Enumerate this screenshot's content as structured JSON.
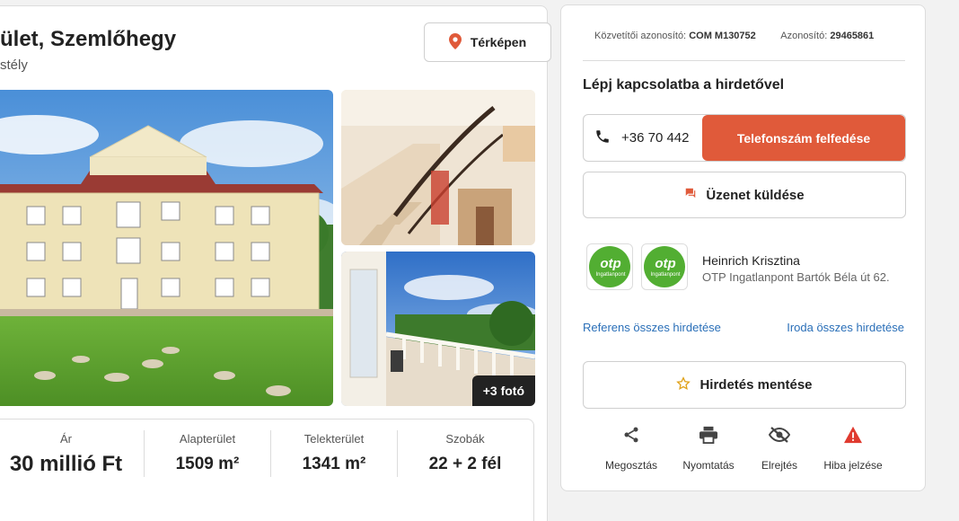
{
  "listing": {
    "title": "ület, Szemlőhegy",
    "subtitle": "stély",
    "map_button": "Térképen",
    "more_photos": "+3 fotó",
    "stats": [
      {
        "label": "Ár",
        "value": "30 millió Ft"
      },
      {
        "label": "Alapterület",
        "value": "1509 m²"
      },
      {
        "label": "Telekterület",
        "value": "1341 m²"
      },
      {
        "label": "Szobák",
        "value": "22 + 2 fél"
      }
    ]
  },
  "sidebar": {
    "broker_id_label": "Közvetítői azonosító:",
    "broker_id_value": "COM M130752",
    "id_label": "Azonosító:",
    "id_value": "29465861",
    "contact_title": "Lépj kapcsolatba a hirdetővel",
    "phone_partial": "+36 70 442",
    "reveal_button": "Telefonszám felfedése",
    "message_button": "Üzenet küldése",
    "logo_text": "otp",
    "logo_subtext": "Ingatlanpont",
    "agent_name": "Heinrich Krisztina",
    "agent_office": "OTP Ingatlanpont Bartók Béla út 62.",
    "link_agent": "Referens összes hirdetése",
    "link_office": "Iroda összes hirdetése",
    "save_button": "Hirdetés mentése",
    "actions": [
      {
        "label": "Megosztás",
        "icon": "share-icon"
      },
      {
        "label": "Nyomtatás",
        "icon": "print-icon"
      },
      {
        "label": "Elrejtés",
        "icon": "hide-icon"
      },
      {
        "label": "Hiba jelzése",
        "icon": "warning-icon"
      }
    ]
  },
  "colors": {
    "accent": "#e05a3a",
    "link": "#2a6fb8",
    "otp_green": "#52ae32"
  }
}
